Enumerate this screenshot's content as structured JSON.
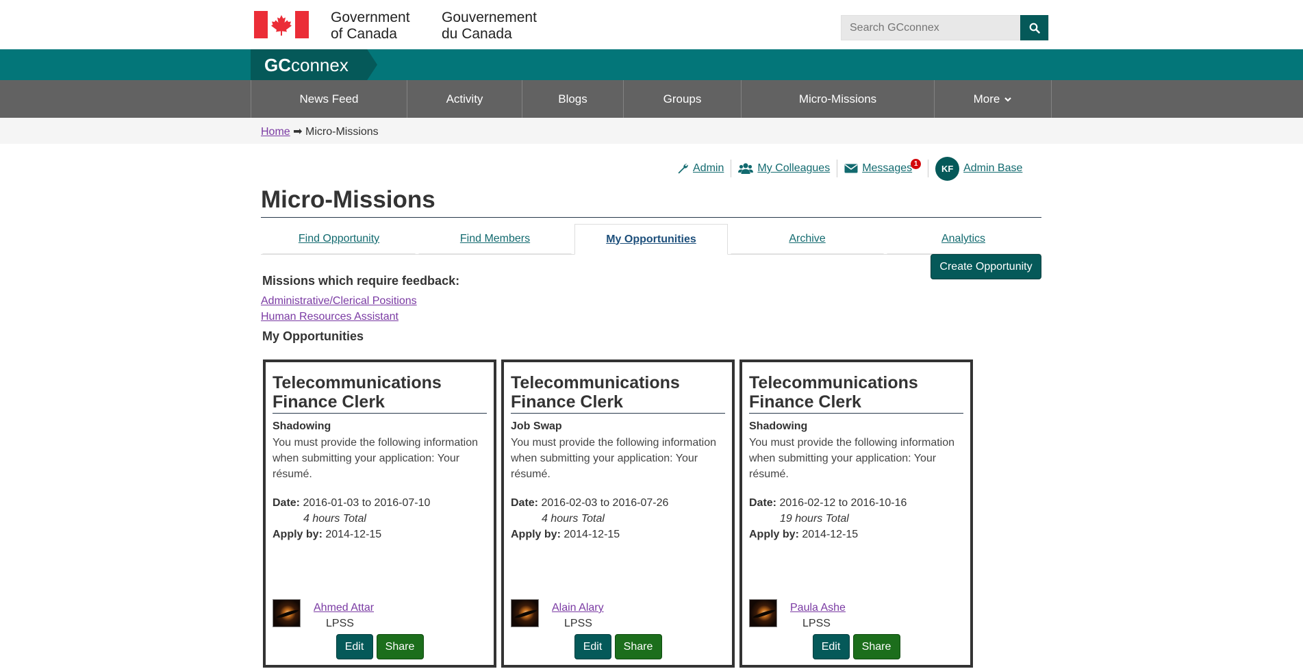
{
  "header": {
    "gov_en_line1": "Government",
    "gov_en_line2": "of Canada",
    "gov_fr_line1": "Gouvernement",
    "gov_fr_line2": "du Canada",
    "search_placeholder": "Search GCconnex"
  },
  "brand": {
    "bold": "GC",
    "rest": "connex"
  },
  "nav": [
    {
      "label": "News Feed"
    },
    {
      "label": "Activity"
    },
    {
      "label": "Blogs"
    },
    {
      "label": "Groups"
    },
    {
      "label": "Micro-Missions"
    },
    {
      "label": "More"
    }
  ],
  "breadcrumb": {
    "home": "Home",
    "arrow": "➡",
    "current": "Micro-Missions"
  },
  "user_menu": {
    "admin": "Admin",
    "colleagues": "My Colleagues",
    "messages": "Messages",
    "messages_count": "1",
    "initials": "KF",
    "user_name": "Admin Base"
  },
  "page_title": "Micro-Missions",
  "tabs": [
    {
      "label": "Find Opportunity"
    },
    {
      "label": "Find Members"
    },
    {
      "label": "My Opportunities"
    },
    {
      "label": "Archive"
    },
    {
      "label": "Analytics"
    }
  ],
  "create_button": "Create Opportunity",
  "feedback": {
    "heading": "Missions which require feedback:",
    "links": [
      "Administrative/Clerical Positions",
      "Human Resources Assistant"
    ]
  },
  "my_opportunities_heading": "My Opportunities",
  "cards": [
    {
      "title": "Telecommunications Finance Clerk",
      "type": "Shadowing",
      "desc": "You must provide the following information when submitting your application: Your résumé.",
      "date_label": "Date:",
      "date": "2016-01-03 to 2016-07-10",
      "hours": "4 hours Total",
      "apply_label": "Apply by:",
      "apply": "2014-12-15",
      "owner": "Ahmed Attar",
      "dept": "LPSS",
      "edit": "Edit",
      "share": "Share"
    },
    {
      "title": "Telecommunications Finance Clerk",
      "type": "Job Swap",
      "desc": "You must provide the following information when submitting your application: Your résumé.",
      "date_label": "Date:",
      "date": "2016-02-03 to 2016-07-26",
      "hours": "4 hours Total",
      "apply_label": "Apply by:",
      "apply": "2014-12-15",
      "owner": "Alain Alary",
      "dept": "LPSS",
      "edit": "Edit",
      "share": "Share"
    },
    {
      "title": "Telecommunications Finance Clerk",
      "type": "Shadowing",
      "desc": "You must provide the following information when submitting your application: Your résumé.",
      "date_label": "Date:",
      "date": "2016-02-12 to 2016-10-16",
      "hours": "19 hours Total",
      "apply_label": "Apply by:",
      "apply": "2014-12-15",
      "owner": "Paula Ashe",
      "dept": "LPSS",
      "edit": "Edit",
      "share": "Share"
    }
  ],
  "colors": {
    "teal_band": "#037679",
    "teal_dark": "#055959",
    "nav_gray": "#626262",
    "flag_red": "#eb2d37",
    "link_visited": "#7a3aa3",
    "share_green": "#1c6e1c"
  }
}
